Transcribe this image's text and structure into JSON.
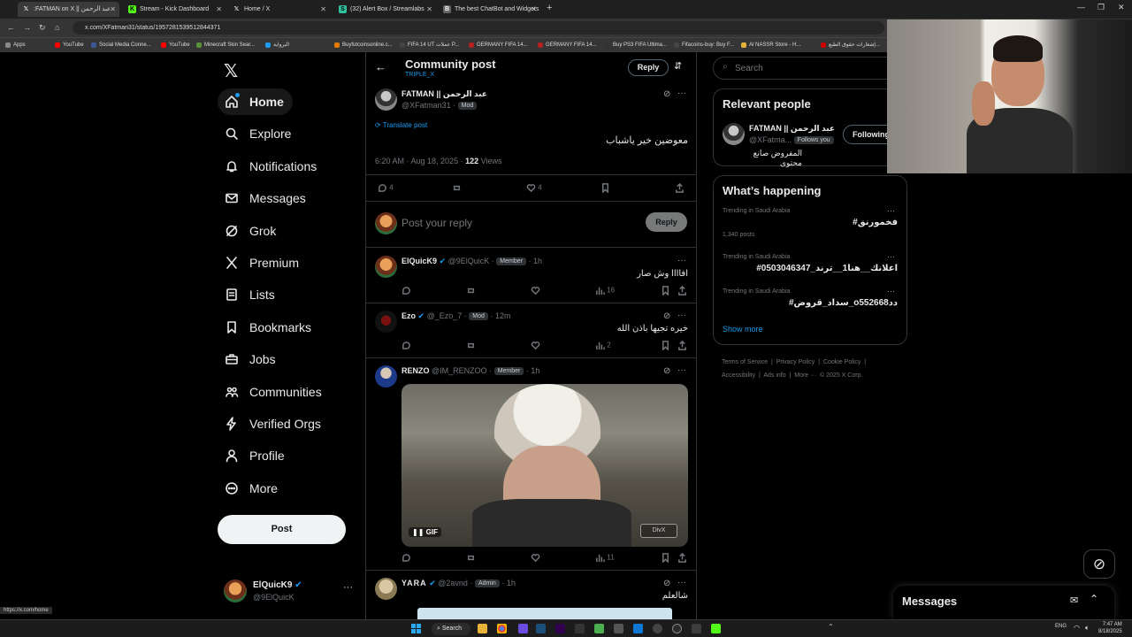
{
  "browser": {
    "tabs": [
      {
        "label": ":FATMAN on X || عبد الرحمن",
        "icon": "X",
        "active": true
      },
      {
        "label": "Stream - Kick Dashboard",
        "icon": "K"
      },
      {
        "label": "Home / X",
        "icon": "X"
      },
      {
        "label": "(32) Alert Box / Streamlabs",
        "icon": "S"
      },
      {
        "label": "The best ChatBot and Widgets",
        "icon": "B"
      }
    ],
    "url": "x.com/XFatman31/status/1957281539512844371",
    "bookmarks": [
      "Apps",
      "YouTube",
      "Social Media Conne...",
      "YouTube",
      "Minecraft Skin Sear...",
      "البرواية",
      "Buyfutcoinsonline.c...",
      "FIFA 14 UT عملات P...",
      "GERMANY FIFA 14...",
      "GERMANY FIFA 14...",
      "Buy PS3 FIFA Ultima...",
      "Fifacoins-buy: Buy F...",
      "Al NASSR Store - H...",
      "إشعارات حقوق الطبع..."
    ],
    "status_url": "https://x.com/home"
  },
  "sidebar": {
    "items": [
      {
        "label": "Home",
        "icon": "home-icon"
      },
      {
        "label": "Explore",
        "icon": "search-icon"
      },
      {
        "label": "Notifications",
        "icon": "bell-icon"
      },
      {
        "label": "Messages",
        "icon": "mail-icon"
      },
      {
        "label": "Grok",
        "icon": "grok-icon"
      },
      {
        "label": "Premium",
        "icon": "x-logo-icon"
      },
      {
        "label": "Lists",
        "icon": "list-icon"
      },
      {
        "label": "Bookmarks",
        "icon": "bookmark-icon"
      },
      {
        "label": "Jobs",
        "icon": "briefcase-icon"
      },
      {
        "label": "Communities",
        "icon": "people-icon"
      },
      {
        "label": "Verified Orgs",
        "icon": "lightning-icon"
      },
      {
        "label": "Profile",
        "icon": "person-icon"
      },
      {
        "label": "More",
        "icon": "more-circle-icon"
      }
    ],
    "post_button": "Post",
    "account": {
      "name": "ElQuicK9",
      "handle": "@9ElQuicK"
    }
  },
  "header": {
    "title": "Community post",
    "subtitle": "TRIPLE_X",
    "reply_button": "Reply"
  },
  "post": {
    "name": "FATMAN || عبد الرحمن",
    "handle": "@XFatman31",
    "badge": "Mod",
    "translate": "Translate post",
    "text": "معوضين خير ياشباب",
    "time": "6:20 AM · Aug 18, 2025 · ",
    "views_count": "122",
    "views_label": " Views",
    "replies": "4",
    "likes": "4"
  },
  "composer": {
    "placeholder": "Post your reply",
    "button": "Reply"
  },
  "replies": [
    {
      "name": "ElQuicK9",
      "handle": "@9ElQuicK",
      "badge": "Member",
      "time": "1h",
      "text": "افاااا وش صار",
      "views": "16"
    },
    {
      "name": "Ezo",
      "handle": "@_Ezo_7",
      "badge": "Mod",
      "time": "12m",
      "text": "خيره تجيها باذن الله",
      "views": "2"
    },
    {
      "name": "RENZO",
      "handle": "@IM_RENZOO",
      "badge": "Member",
      "time": "1h",
      "gif_label": "GIF",
      "views": "11"
    },
    {
      "name": "YARA",
      "handle": "@2avnd",
      "badge": "Admin",
      "time": "1h",
      "text": "شالعلم"
    }
  ],
  "right": {
    "search_placeholder": "Search",
    "relevant_title": "Relevant people",
    "relevant": {
      "name": "FATMAN || عبد الرحمن",
      "handle": "@XFatma...",
      "follows": "Follows you",
      "button": "Following",
      "bio": "المفروض صانع محتوى"
    },
    "happening_title": "What’s happening",
    "trends": [
      {
        "meta": "Trending in Saudi Arabia",
        "name": "#فخمورنق",
        "posts": "1,340 posts"
      },
      {
        "meta": "Trending in Saudi Arabia",
        "name": "#اعلانك__هنا1__ترند_0503046347",
        "posts": ""
      },
      {
        "meta": "Trending in Saudi Arabia",
        "name": "#سداد_قروض_o55دد2668",
        "posts": ""
      }
    ],
    "show_more": "Show more",
    "footer": [
      "Terms of Service",
      "Privacy Policy",
      "Cookie Policy",
      "Accessibility",
      "Ads info",
      "More ···",
      "© 2025 X Corp."
    ],
    "messages_title": "Messages"
  },
  "taskbar": {
    "search": "Search",
    "lang": "ENG",
    "time": "7:47 AM",
    "date": "8/18/2025"
  },
  "colors": {
    "accent": "#1d9bf0",
    "bg": "#000000",
    "border": "#2f3336",
    "muted": "#71767b"
  }
}
